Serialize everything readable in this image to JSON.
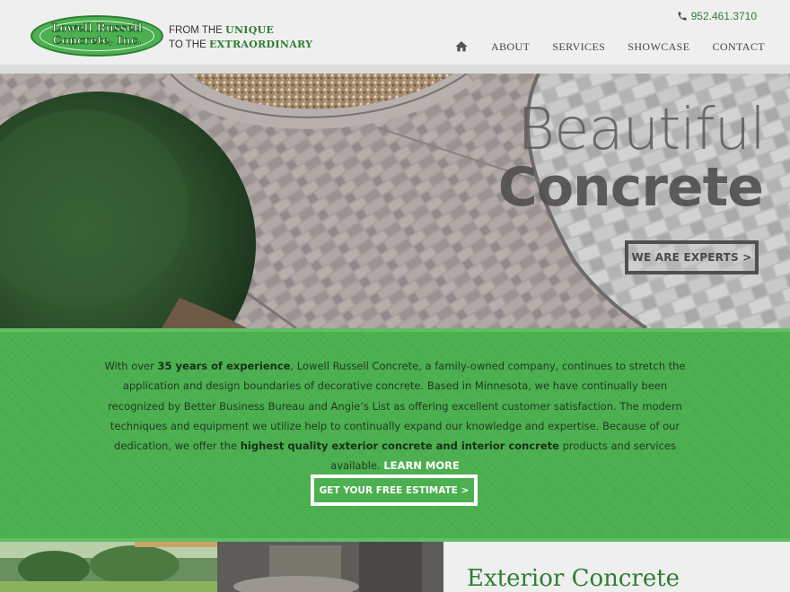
{
  "brand": {
    "logo_line1": "Lowell Russell",
    "logo_line2": "Concrete, Inc.",
    "tagline_prefix1": "FROM THE ",
    "tagline_emph1": "UNIQUE",
    "tagline_prefix2": "TO THE ",
    "tagline_emph2": "EXTRAORDINARY"
  },
  "header": {
    "phone": "952.461.3710",
    "phone_icon": "phone-icon",
    "home_icon": "home-icon",
    "nav": [
      "ABOUT",
      "SERVICES",
      "SHOWCASE",
      "CONTACT"
    ]
  },
  "hero": {
    "line1": "Beautiful",
    "line2": "Concrete",
    "button": "WE ARE EXPERTS >"
  },
  "intro": {
    "p1": "With over ",
    "p1_bold": "35 years of experience",
    "p2": ", Lowell Russell Concrete, a family-owned company, continues to stretch the application and design boundaries of decorative concrete. Based in Minnesota, we have continually been recognized by Better Business Bureau and Angie’s List as offering excellent customer satisfaction. The modern techniques and equipment we utilize help to continually expand our knowledge and expertise. Because of our dedication, we offer the ",
    "p2_bold": "highest quality exterior concrete and interior concrete",
    "p3": " products and services available. ",
    "learn_more": "LEARN MORE",
    "estimate_button": "GET YOUR FREE ESTIMATE >"
  },
  "section": {
    "title": "Exterior Concrete"
  },
  "colors": {
    "brand_green": "#4caf50",
    "dark_green": "#2e7d32",
    "header_bg": "#efefef"
  }
}
